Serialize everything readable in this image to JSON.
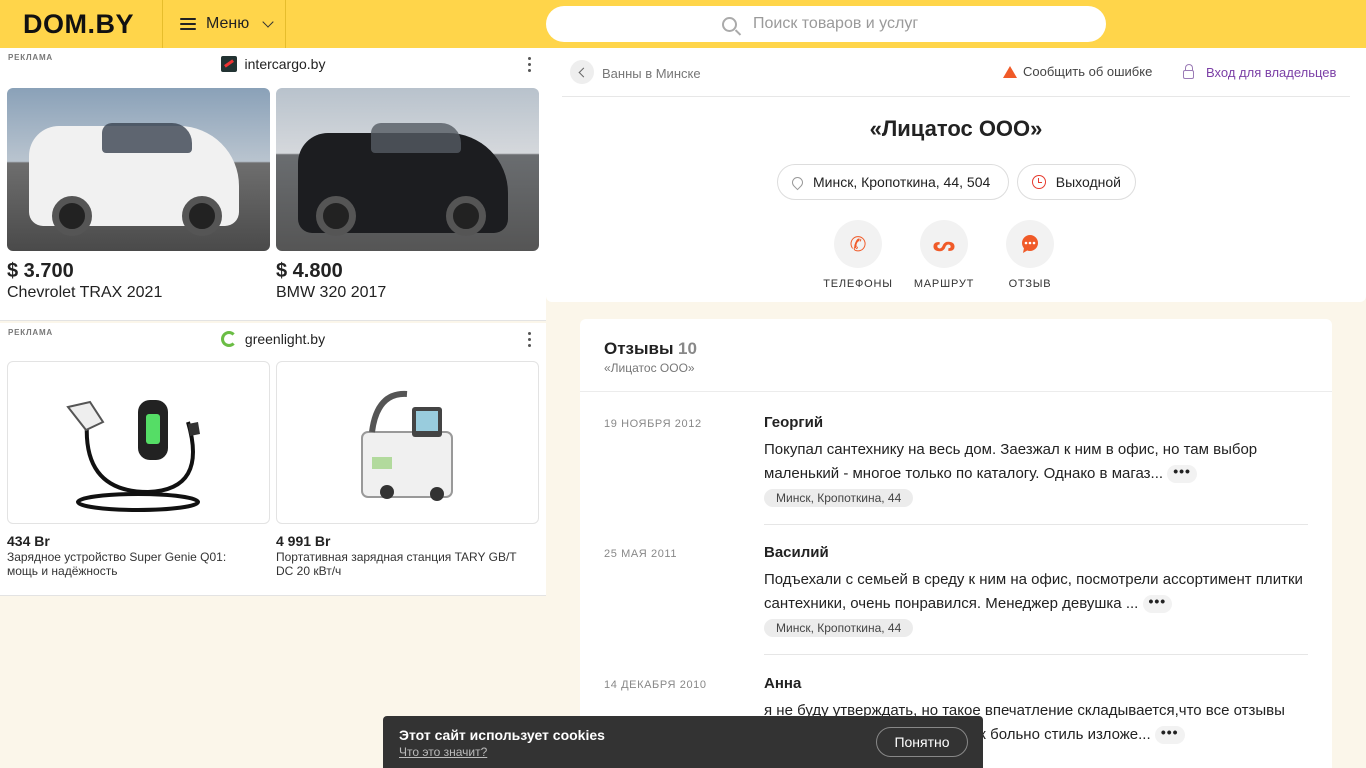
{
  "header": {
    "logo": "DOM.BY",
    "menu_label": "Меню",
    "search_placeholder": "Поиск товаров и услуг",
    "accent_color": "#ffd54a"
  },
  "ads": [
    {
      "label": "РЕКЛАМА",
      "brand": "intercargo.by",
      "items": [
        {
          "price": "$ 3.700",
          "title": "Chevrolet TRAX 2021"
        },
        {
          "price": "$ 4.800",
          "title": "BMW 320 2017"
        }
      ]
    },
    {
      "label": "РЕКЛАМА",
      "brand": "greenlight.by",
      "items": [
        {
          "price": "434 Br",
          "title": "Зарядное устройство Super Genie Q01: мощь и надёжность"
        },
        {
          "price": "4 991 Br",
          "title": "Портативная зарядная станция TARY GB/T DC 20 кВт/ч"
        }
      ]
    }
  ],
  "company": {
    "breadcrumb": "Ванны в Минске",
    "report": "Сообщить об ошибке",
    "owner_login": "Вход для владельцев",
    "name": "«Лицатос ООО»",
    "address": "Минск, Кропоткина, 44, 504",
    "hours": "Выходной",
    "actions": {
      "phones": "ТЕЛЕФОНЫ",
      "route": "МАРШРУТ",
      "review": "ОТЗЫВ"
    }
  },
  "reviews": {
    "title": "Отзывы",
    "count": "10",
    "subtitle": "«Лицатос ООО»",
    "items": [
      {
        "date": "19 НОЯБРЯ 2012",
        "author": "Георгий",
        "text": "Покупал сантехнику на весь дом. Заезжал к ним в офис, но там выбор маленький - многое только по каталогу. Однако в магаз...",
        "address": "Минск, Кропоткина, 44"
      },
      {
        "date": "25 МАЯ 2011",
        "author": "Василий",
        "text": "Подъехали с семьей в среду  к ним на офис, посмотрели ассортимент плитки сантехники, очень понравился. Менеджер девушка ...",
        "address": "Минск, Кропоткина, 44"
      },
      {
        "date": "14 ДЕКАБРЯ 2010",
        "author": "Анна",
        "text": "я не буду утверждать, но такое впечатление складывается,что все отзывы написаны одним человеком. Уж больно стиль изложе...",
        "address": ""
      }
    ],
    "more_label": "•••"
  },
  "cookie": {
    "title": "Этот сайт использует cookies",
    "link": "Что это значит?",
    "button": "Понятно"
  }
}
